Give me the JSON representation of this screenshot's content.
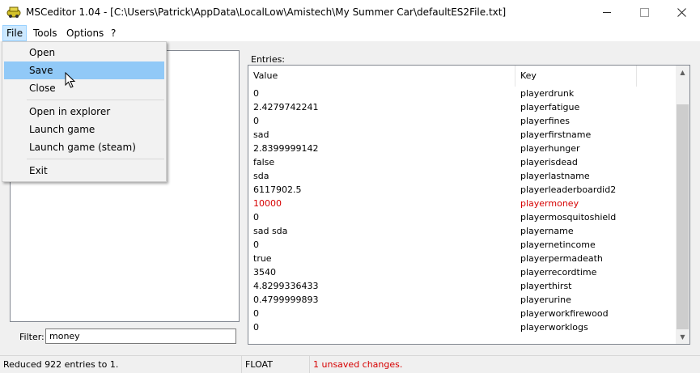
{
  "window": {
    "title": "MSCeditor 1.04 - [C:\\Users\\Patrick\\AppData\\LocalLow\\Amistech\\My Summer Car\\defaultES2File.txt]",
    "controls": {
      "minimize": "–",
      "maximize": "☐",
      "close": "✕"
    }
  },
  "menubar": {
    "file": "File",
    "tools": "Tools",
    "options": "Options",
    "help": "?"
  },
  "file_menu": {
    "items": [
      "Open",
      "Save",
      "Close",
      "Open in explorer",
      "Launch game",
      "Launch game (steam)",
      "Exit"
    ],
    "hovered": "Save"
  },
  "filter": {
    "label": "Filter:",
    "value": "money"
  },
  "entries": {
    "label": "Entries:",
    "columns": [
      "Value",
      "Key"
    ],
    "rows": [
      {
        "value": "0",
        "key": "playerdrunk"
      },
      {
        "value": "2.4279742241",
        "key": "playerfatigue"
      },
      {
        "value": "0",
        "key": "playerfines"
      },
      {
        "value": "sad",
        "key": "playerfirstname"
      },
      {
        "value": "2.8399999142",
        "key": "playerhunger"
      },
      {
        "value": "false",
        "key": "playerisdead"
      },
      {
        "value": "sda",
        "key": "playerlastname"
      },
      {
        "value": "6117902.5",
        "key": "playerleaderboardid2"
      },
      {
        "value": "10000",
        "key": "playermoney"
      },
      {
        "value": "0",
        "key": "playermosquitoshield"
      },
      {
        "value": "sad sda",
        "key": "playername"
      },
      {
        "value": "0",
        "key": "playernetincome"
      },
      {
        "value": "true",
        "key": "playerpermadeath"
      },
      {
        "value": "3540",
        "key": "playerrecordtime"
      },
      {
        "value": "4.8299336433",
        "key": "playerthirst"
      },
      {
        "value": "0.4799999893",
        "key": "playerurine"
      },
      {
        "value": "0",
        "key": "playerworkfirewood"
      },
      {
        "value": "0",
        "key": "playerworklogs"
      }
    ],
    "highlighted_key": "playermoney",
    "highlight_color": "#d60000"
  },
  "status": {
    "message": "Reduced 922 entries to 1.",
    "type": "FLOAT",
    "changes": "1 unsaved changes."
  }
}
